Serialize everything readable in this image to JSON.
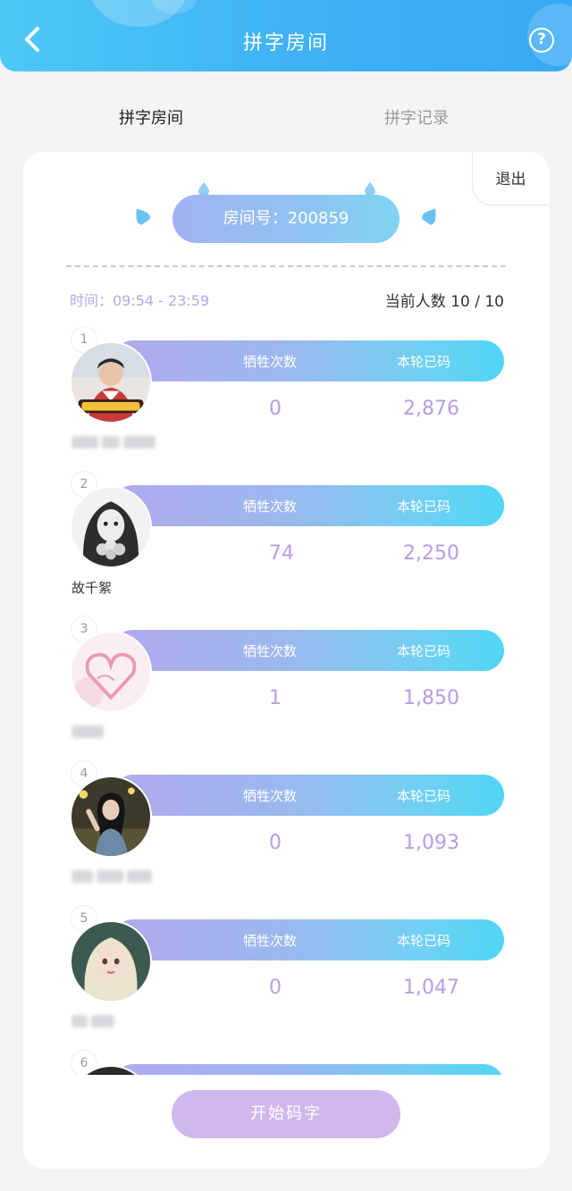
{
  "header": {
    "title": "拼字房间",
    "help_label": "?"
  },
  "tabs": [
    {
      "label": "拼字房间",
      "active": true
    },
    {
      "label": "拼字记录",
      "active": false
    }
  ],
  "room": {
    "exit_label": "退出",
    "room_number": "房间号：200859",
    "time": "时间：09:54 - 23:59",
    "member_count": "当前人数 10 / 10"
  },
  "columns": {
    "sacrifice": "牺牲次数",
    "typed": "本轮已码"
  },
  "members": [
    {
      "rank": "1",
      "nickname": "",
      "nickname_blurred": true,
      "sacrifice": "0",
      "typed": "2,876",
      "avatar_icon": "avatar-1-icon"
    },
    {
      "rank": "2",
      "nickname": "故千絮",
      "nickname_blurred": false,
      "sacrifice": "74",
      "typed": "2,250",
      "avatar_icon": "avatar-2-icon"
    },
    {
      "rank": "3",
      "nickname": "",
      "nickname_blurred": true,
      "sacrifice": "1",
      "typed": "1,850",
      "avatar_icon": "avatar-3-icon"
    },
    {
      "rank": "4",
      "nickname": "",
      "nickname_blurred": true,
      "sacrifice": "0",
      "typed": "1,093",
      "avatar_icon": "avatar-4-icon"
    },
    {
      "rank": "5",
      "nickname": "",
      "nickname_blurred": true,
      "sacrifice": "0",
      "typed": "1,047",
      "avatar_icon": "avatar-5-icon"
    },
    {
      "rank": "6",
      "nickname": "",
      "nickname_blurred": true,
      "sacrifice": "",
      "typed": "",
      "avatar_icon": "avatar-6-icon"
    }
  ],
  "start_button": "开始码字",
  "colors": {
    "header": "#3fb3f5",
    "accent_purple": "#b89ce6",
    "start_button": "#d0b7ec"
  }
}
